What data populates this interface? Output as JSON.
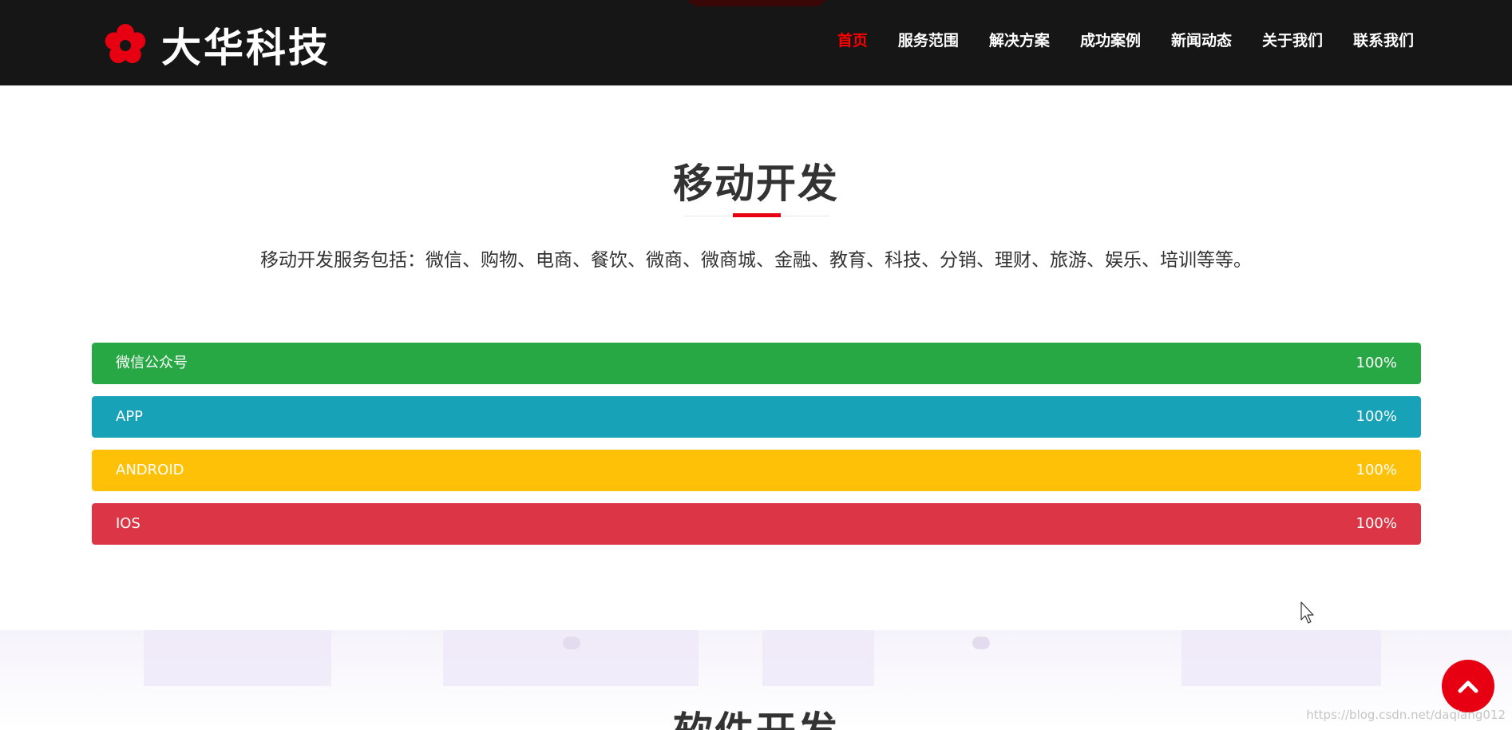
{
  "header": {
    "brand": {
      "name": "大华科技",
      "icon": "flower-icon"
    },
    "nav": [
      {
        "label": "首页",
        "active": true
      },
      {
        "label": "服务范围",
        "active": false
      },
      {
        "label": "解决方案",
        "active": false
      },
      {
        "label": "成功案例",
        "active": false
      },
      {
        "label": "新闻动态",
        "active": false
      },
      {
        "label": "关于我们",
        "active": false
      },
      {
        "label": "联系我们",
        "active": false
      }
    ]
  },
  "section": {
    "title": "移动开发",
    "description": "移动开发服务包括：微信、购物、电商、餐饮、微商、微商城、金融、教育、科技、分销、理财、旅游、娱乐、培训等等。"
  },
  "bars": [
    {
      "label": "微信公众号",
      "value": "100%",
      "percent": 100,
      "color": "#28a745"
    },
    {
      "label": "APP",
      "value": "100%",
      "percent": 100,
      "color": "#17a2b8"
    },
    {
      "label": "ANDROID",
      "value": "100%",
      "percent": 100,
      "color": "#ffc107"
    },
    {
      "label": "IOS",
      "value": "100%",
      "percent": 100,
      "color": "#dc3545"
    }
  ],
  "next_section": {
    "title": "软件开发"
  },
  "back_to_top": {
    "icon": "chevron-up-icon"
  },
  "watermark": "https://blog.csdn.net/daqiang012",
  "colors": {
    "accent": "#e60012",
    "header_bg": "#161616"
  }
}
